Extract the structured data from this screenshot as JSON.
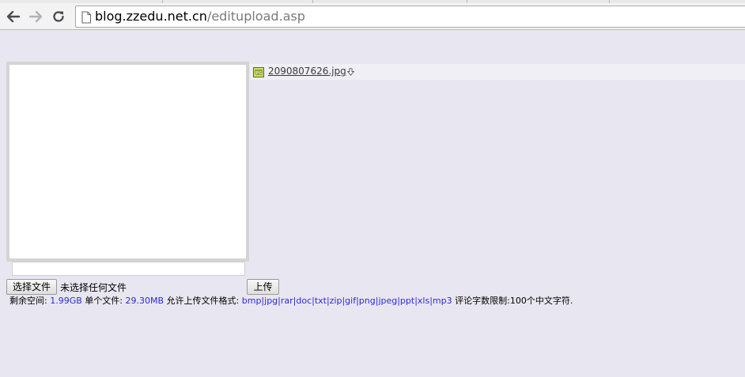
{
  "browser": {
    "url_host": "blog.zzedu.net.cn",
    "url_path": "/editupload.asp",
    "icons": [
      "back-arrow-icon",
      "forward-arrow-icon",
      "reload-icon",
      "page-icon"
    ]
  },
  "attachment": {
    "filename": "2090807626.jpg",
    "icons": [
      "jpg-file-icon",
      "insert-arrow-icon"
    ]
  },
  "form": {
    "choose_button": "选择文件",
    "no_file_text": "未选择任何文件",
    "upload_button": "上传",
    "text_value": ""
  },
  "info": {
    "space_label": "剩余空间:",
    "space_value": "1.99GB",
    "single_label": "单个文件:",
    "single_value": "29.30MB",
    "formats_label": "允许上传文件格式:",
    "formats_value": "bmp|jpg|rar|doc|txt|zip|gif|png|jpeg|ppt|xls|mp3",
    "limit_text": "评论字数限制:100个中文字符."
  },
  "colors": {
    "page_background": "#e8e6f0",
    "link_value_blue": "#2b2bd6"
  }
}
